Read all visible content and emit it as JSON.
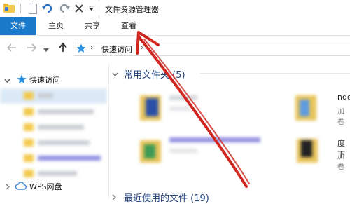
{
  "window": {
    "title": "文件资源管理器"
  },
  "ribbon": {
    "tabs": [
      {
        "label": "文件"
      },
      {
        "label": "主页"
      },
      {
        "label": "共享"
      },
      {
        "label": "查看"
      }
    ]
  },
  "address": {
    "location": "快速访问"
  },
  "sidebar": {
    "quick_access": "快速访问",
    "wps": "WPS网盘"
  },
  "main": {
    "frequent_title": "常用文件夹 (5)",
    "recent_title": "最近使用的文件 (19)",
    "tile_right_top_name": "ndo",
    "tile_right_top_sub": "加卷",
    "tile_right_bottom_name": "度下",
    "tile_right_bottom_sub": "加卷"
  },
  "colors": {
    "file_tab": "#1979ca",
    "arrow": "#d0261f",
    "heading": "#1e3f7a"
  }
}
